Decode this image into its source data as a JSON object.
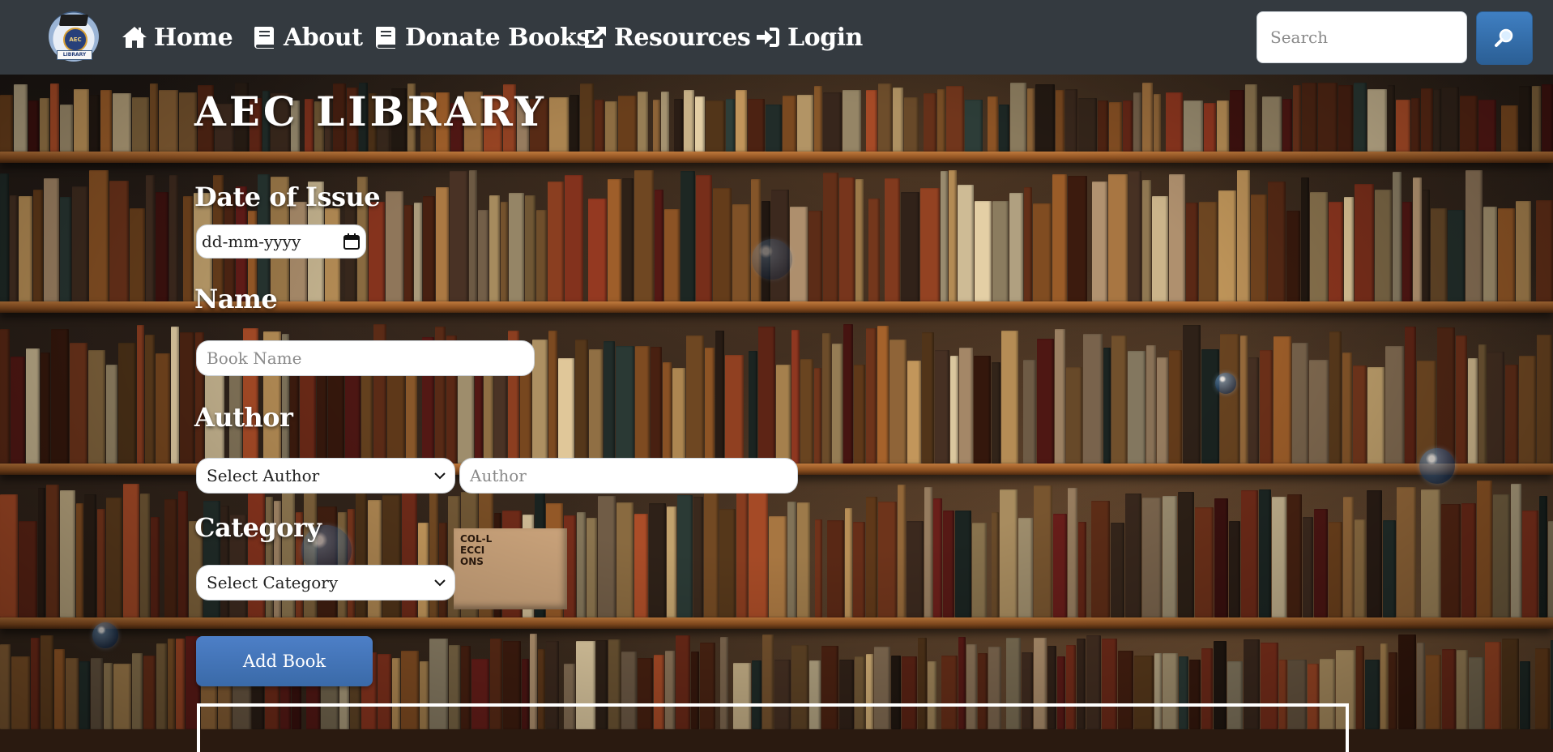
{
  "navbar": {
    "logo_text_top": "AEC",
    "logo_text_bottom": "LIBRARY",
    "links": [
      {
        "label": "Home",
        "icon": "home-icon"
      },
      {
        "label": "About",
        "icon": "book-icon"
      },
      {
        "label": "Donate Books",
        "icon": "book-icon"
      },
      {
        "label": "Resources",
        "icon": "external-link-icon"
      },
      {
        "label": "Login",
        "icon": "sign-in-icon"
      }
    ],
    "search": {
      "placeholder": "Search",
      "button_icon": "search-icon"
    }
  },
  "form": {
    "title": "AEC LIBRARY",
    "date_label": "Date of Issue",
    "date_placeholder": "dd-mm-yyyy",
    "name_label": "Name",
    "name_placeholder": "Book Name",
    "author_label": "Author",
    "author_select_value": "Select Author",
    "author_placeholder": "Author",
    "category_label": "Category",
    "category_select_value": "Select Category",
    "submit_label": "Add Book"
  },
  "background": {
    "book_text": [
      "COL-L",
      "ECCI",
      "ONS"
    ]
  },
  "colors": {
    "navbar_bg": "#343a40",
    "accent_blue": "#3a6aa8",
    "text_white": "#ffffff"
  }
}
